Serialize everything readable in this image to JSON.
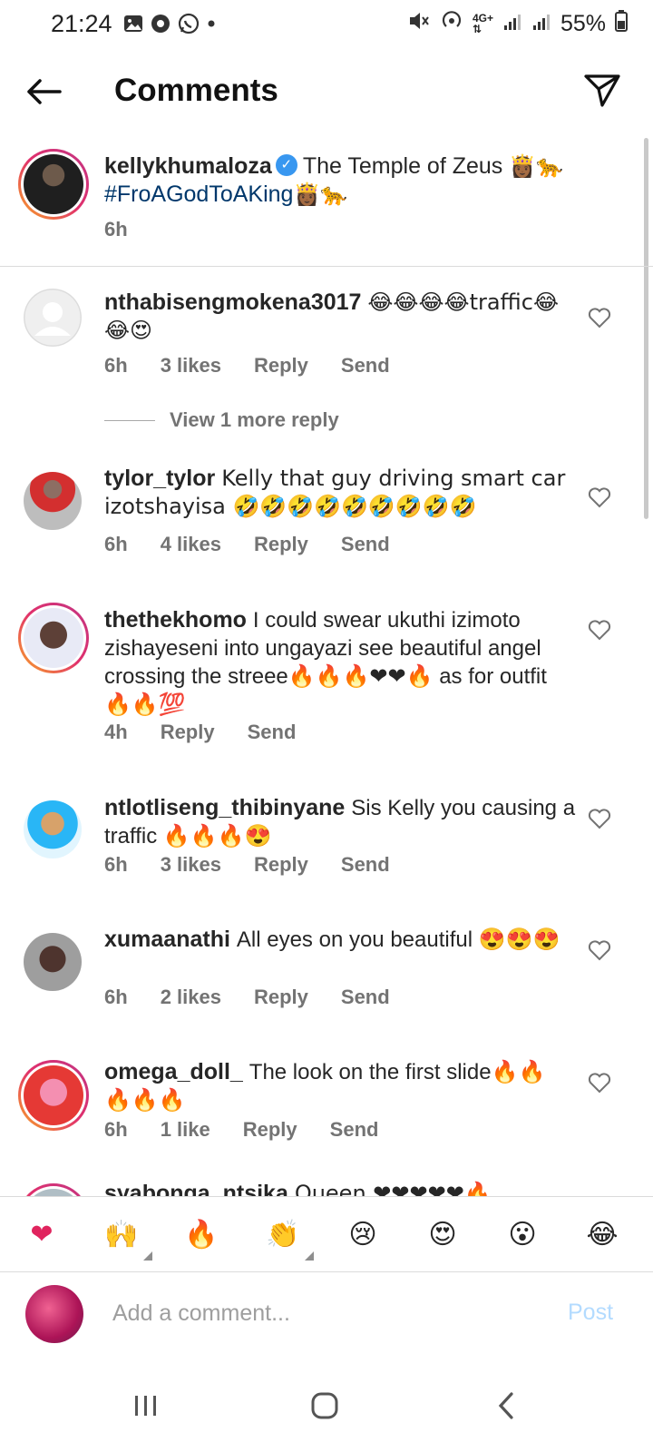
{
  "status_bar": {
    "time": "21:24",
    "battery": "55%"
  },
  "header": {
    "title": "Comments"
  },
  "caption": {
    "username": "kellykhumaloza",
    "text": "The Temple of Zeus",
    "text_emojis": "👸🏾🐆",
    "hashtag": "#FroAGodToAKing",
    "hashtag_emojis": "👸🏾🐆",
    "time": "6h"
  },
  "comments": [
    {
      "username": "nthabisengmokena3017",
      "text": "😂😂😂😂traffic😂😂😍",
      "time": "6h",
      "likes": "3 likes",
      "reply": "Reply",
      "send": "Send"
    },
    {
      "username": "tylor_tylor",
      "text": "Kelly that guy driving smart car izotshayisa 🤣🤣🤣🤣🤣🤣🤣🤣🤣",
      "time": "6h",
      "likes": "4 likes",
      "reply": "Reply",
      "send": "Send"
    },
    {
      "username": "thethekhomo",
      "text": "I could  swear ukuthi  izimoto zishayeseni into ungayazi see beautiful angel crossing the streee🔥🔥🔥❤❤🔥 as for outfit 🔥🔥💯",
      "time": "4h",
      "likes": "",
      "reply": "Reply",
      "send": "Send"
    },
    {
      "username": "ntlotliseng_thibinyane",
      "text": "Sis Kelly you causing a traffic 🔥🔥🔥😍",
      "time": "6h",
      "likes": "3 likes",
      "reply": "Reply",
      "send": "Send"
    },
    {
      "username": "xumaanathi",
      "text": "All eyes on you beautiful 😍😍😍",
      "time": "6h",
      "likes": "2 likes",
      "reply": "Reply",
      "send": "Send"
    },
    {
      "username": "omega_doll_",
      "text": "The look on the first slide🔥🔥🔥🔥🔥",
      "time": "6h",
      "likes": "1 like",
      "reply": "Reply",
      "send": "Send"
    }
  ],
  "view_more_reply": "View 1 more reply",
  "partial_comment": {
    "username": "syabonga_ntsika",
    "text": "Queen ❤❤❤❤❤🔥"
  },
  "quick_emojis": [
    "❤",
    "🙌",
    "🔥",
    "👏",
    "😢",
    "😍",
    "😮",
    "😂"
  ],
  "composer": {
    "placeholder": "Add a comment...",
    "post_label": "Post"
  },
  "colors": {
    "accent": "#3897f0",
    "post_disabled": "#b3dbff",
    "hashtag": "#00376b",
    "meta": "#737373"
  }
}
